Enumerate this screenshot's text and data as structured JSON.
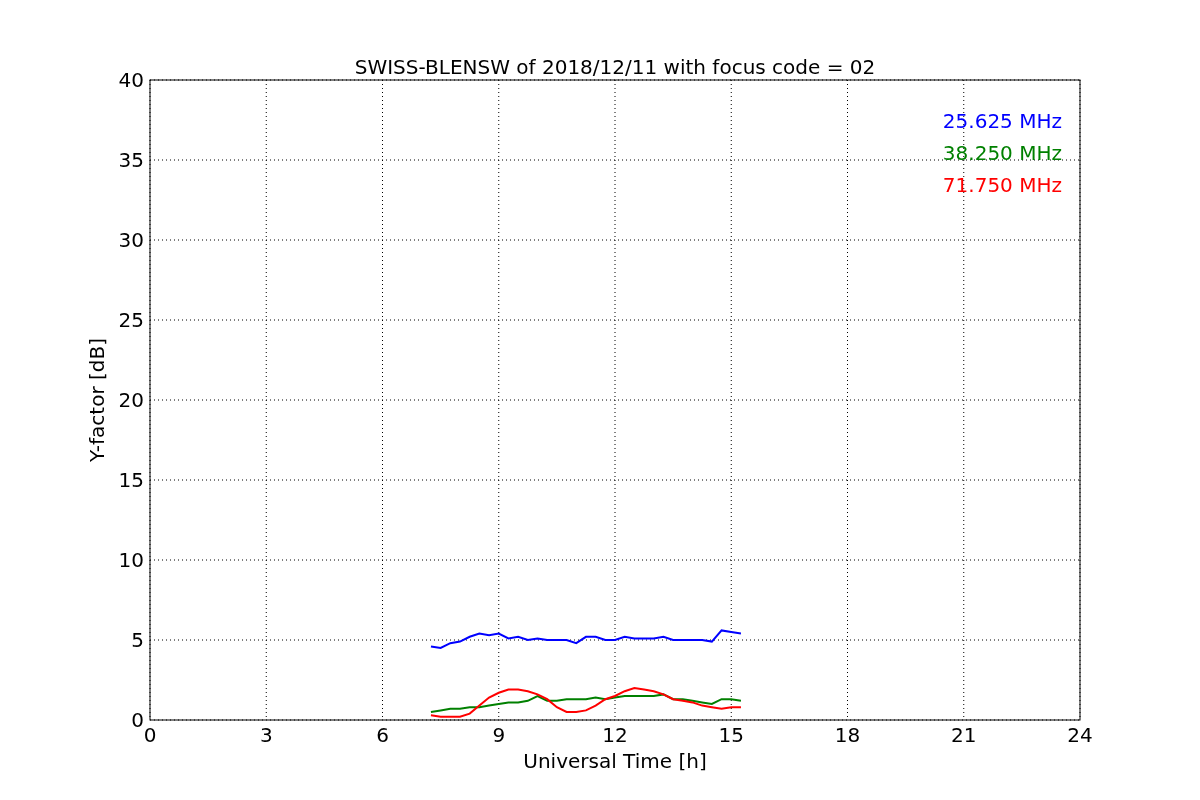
{
  "chart_data": {
    "type": "line",
    "title": "SWISS-BLENSW of 2018/12/11 with focus code = 02",
    "xlabel": "Universal Time [h]",
    "ylabel": "Y-factor [dB]",
    "xlim": [
      0,
      24
    ],
    "ylim": [
      0,
      40
    ],
    "xticks": [
      0,
      3,
      6,
      9,
      12,
      15,
      18,
      21,
      24
    ],
    "yticks": [
      0,
      5,
      10,
      15,
      20,
      25,
      30,
      35,
      40
    ],
    "grid": true,
    "x": [
      7.25,
      7.5,
      7.75,
      8.0,
      8.25,
      8.5,
      8.75,
      9.0,
      9.25,
      9.5,
      9.75,
      10.0,
      10.25,
      10.5,
      10.75,
      11.0,
      11.25,
      11.5,
      11.75,
      12.0,
      12.25,
      12.5,
      12.75,
      13.0,
      13.25,
      13.5,
      13.75,
      14.0,
      14.25,
      14.5,
      14.75,
      15.0,
      15.25
    ],
    "series": [
      {
        "name": "25.625 MHz",
        "color": "#0000ff",
        "values": [
          4.6,
          4.5,
          4.8,
          4.9,
          5.2,
          5.4,
          5.3,
          5.4,
          5.1,
          5.2,
          5.0,
          5.1,
          5.0,
          5.0,
          5.0,
          4.8,
          5.2,
          5.2,
          5.0,
          5.0,
          5.2,
          5.1,
          5.1,
          5.1,
          5.2,
          5.0,
          5.0,
          5.0,
          5.0,
          4.9,
          5.6,
          5.5,
          5.4
        ]
      },
      {
        "name": "38.250 MHz",
        "color": "#008000",
        "values": [
          0.5,
          0.6,
          0.7,
          0.7,
          0.8,
          0.8,
          0.9,
          1.0,
          1.1,
          1.1,
          1.2,
          1.5,
          1.2,
          1.2,
          1.3,
          1.3,
          1.3,
          1.4,
          1.3,
          1.4,
          1.5,
          1.5,
          1.5,
          1.5,
          1.6,
          1.3,
          1.3,
          1.2,
          1.1,
          1.0,
          1.3,
          1.3,
          1.2
        ]
      },
      {
        "name": "71.750 MHz",
        "color": "#ff0000",
        "values": [
          0.3,
          0.2,
          0.2,
          0.2,
          0.4,
          0.9,
          1.4,
          1.7,
          1.9,
          1.9,
          1.8,
          1.6,
          1.3,
          0.8,
          0.5,
          0.5,
          0.6,
          0.9,
          1.3,
          1.5,
          1.8,
          2.0,
          1.9,
          1.8,
          1.6,
          1.3,
          1.2,
          1.1,
          0.9,
          0.8,
          0.7,
          0.8,
          0.8
        ]
      }
    ]
  }
}
